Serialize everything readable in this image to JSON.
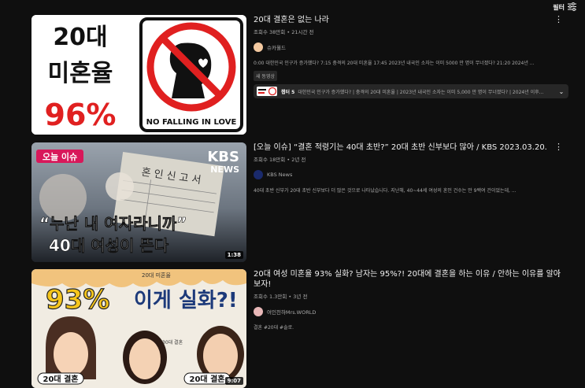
{
  "header": {
    "filter_label": "필터",
    "filter_icon": "sliders-icon"
  },
  "results": [
    {
      "title": "20대 결혼은 없는 나라",
      "views": "조회수 38만회",
      "age": "21시간 전",
      "channel": "슈카월드",
      "description": "0:00 대한민국 인구가 증가했다? 7:15 충격의 20대 미혼율 17:45 2023년 내국인 소자는 이미 5000 만 명이 무너졌다? 21:20 2024년 ...",
      "badge": "새 동영상",
      "thumb_text": {
        "line1": "20대",
        "line2": "미혼율",
        "line3": "96%",
        "sign": "NO FALLING IN LOVE"
      },
      "chapters": {
        "label": "챕터 5",
        "list": "대한민국 인구가 증가했다? | 충격의 20대 미혼율 | 2023년 내국인 소자는 이미 5,000 만 명이 무너졌다? | 2024년 이후..."
      }
    },
    {
      "title": "[오늘 이슈] “결혼 적령기는 40대 초반?” 20대 초반 신부보다 많아 / KBS 2023.03.20.",
      "views": "조회수 18만회",
      "age": "2년 전",
      "channel": "KBS News",
      "description": "40대 초반 신부가 20대 초반 신부보다 더 많은 것으로 나타났습니다. 지난해, 40~44세 여성의 혼인 건수는 만 9백여 건이었는데, ...",
      "duration": "1:38",
      "thumb_text": {
        "tag": "오늘 이슈",
        "logo1": "KBS",
        "logo2": "NEWS",
        "quote": "“누난 내 여자라니까”",
        "caption": "40대 여성이 뜬다",
        "form": "혼 인 신 고 서"
      }
    },
    {
      "title": "20대 여성 미혼율 93% 실화? 남자는 95%?! 20대에 결혼을 하는 이유 / 안하는 이유를 알아보자!",
      "views": "조회수 1.3만회",
      "age": "3년 전",
      "channel": "여인천하Mrs.WORLD",
      "description": "결혼 #20대 #솔로.",
      "duration": "9:07",
      "thumb_text": {
        "big": "93%",
        "rest": "이게 실화?!",
        "small1": "20대 미혼율",
        "small2": "30대 결혼",
        "tag1": "20대 결혼",
        "tag2": "20대 결혼"
      }
    }
  ],
  "colors": {
    "background": "#0f0f0f",
    "text": "#f1f1f1",
    "muted": "#aaaaaa",
    "accent_red": "#e02020"
  }
}
